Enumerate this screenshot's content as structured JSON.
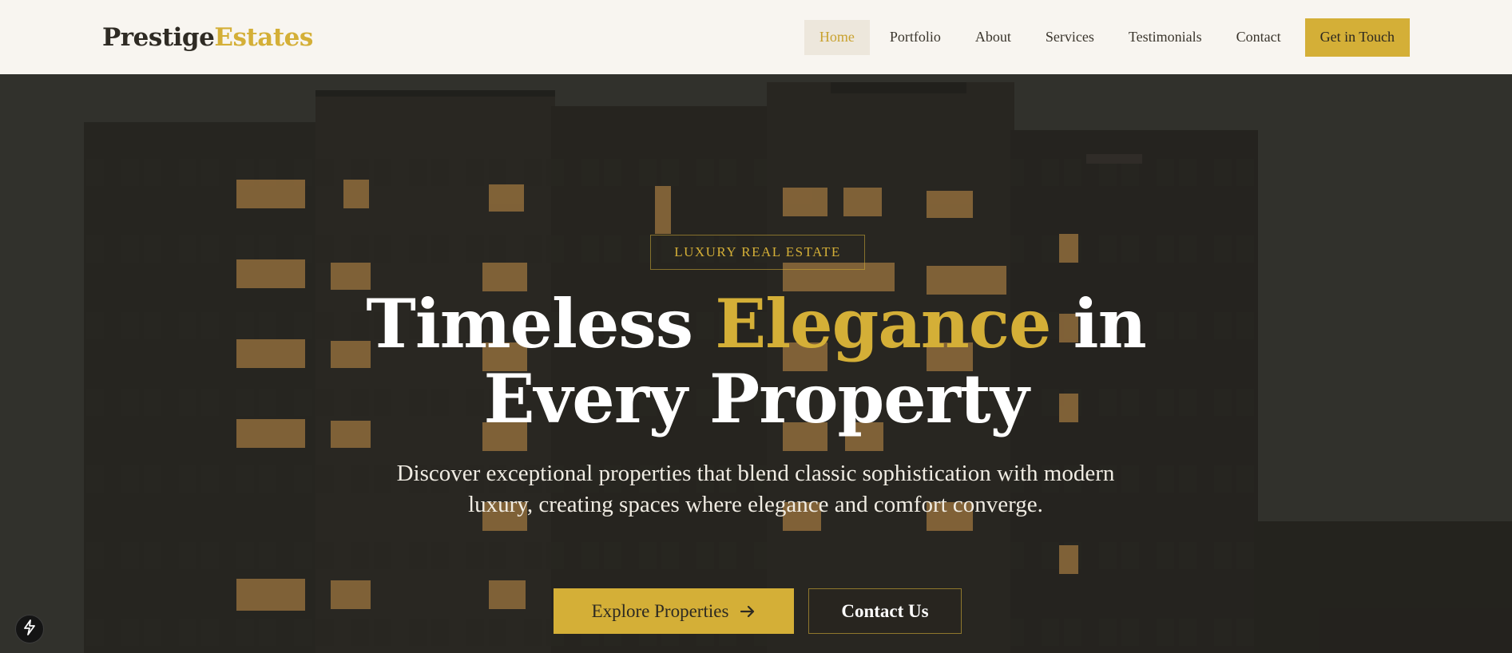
{
  "header": {
    "logo_part1": "Prestige",
    "logo_part2": "Estates",
    "nav": [
      {
        "label": "Home",
        "active": true
      },
      {
        "label": "Portfolio"
      },
      {
        "label": "About"
      },
      {
        "label": "Services"
      },
      {
        "label": "Testimonials"
      },
      {
        "label": "Contact"
      }
    ],
    "cta_label": "Get in Touch"
  },
  "hero": {
    "eyebrow": "LUXURY REAL ESTATE",
    "headline_part1": "Timeless ",
    "headline_highlight": "Elegance",
    "headline_part2": " in",
    "headline_line2": "Every Property",
    "subtext": "Discover exceptional properties that blend classic sophistication with modern luxury, creating spaces where elegance and comfort converge.",
    "primary_button": "Explore Properties",
    "primary_button_icon": "arrow-right-icon",
    "secondary_button": "Contact Us",
    "background_image": "dusk apartment building facade"
  },
  "floating_badge_icon": "lightning-icon",
  "colors": {
    "accent": "#d4af37",
    "header_bg": "#f8f5f0",
    "text_dark": "#2f2b24",
    "hero_text": "#ffffff"
  }
}
